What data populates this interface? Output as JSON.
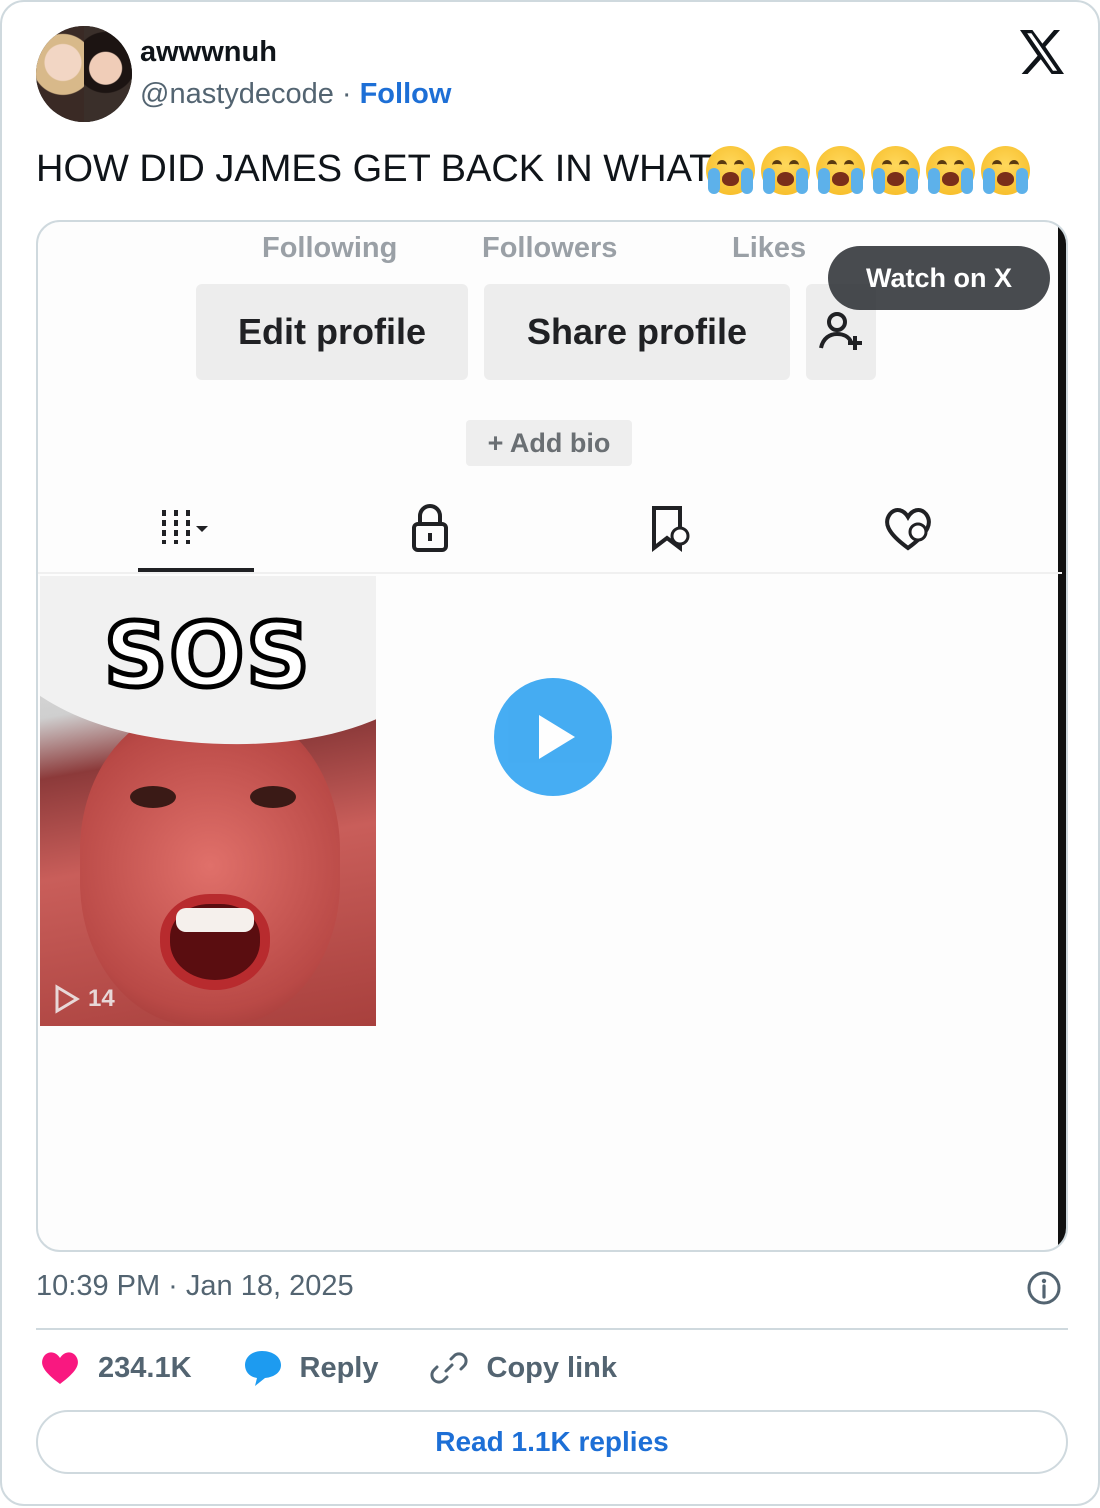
{
  "author": {
    "name": "awwwnuh",
    "handle": "@nastydecode",
    "separator": "·",
    "follow_label": "Follow"
  },
  "tweet": {
    "text": "HOW DID JAMES GET BACK IN WHAT",
    "emoji_count": 6,
    "emoji_name": "loudly-crying-face"
  },
  "media": {
    "watch_label": "Watch on X",
    "screen": {
      "stats": [
        "Following",
        "Followers",
        "Likes"
      ],
      "edit_profile": "Edit profile",
      "share_profile": "Share profile",
      "add_bio": "+ Add bio",
      "tabs": [
        "grid-icon",
        "lock-icon",
        "bookmark-icon",
        "liked-icon"
      ],
      "thumbnail_caption": "SOS",
      "thumbnail_views": "14"
    }
  },
  "meta": {
    "timestamp": "10:39 PM · Jan 18, 2025"
  },
  "actions": {
    "likes": "234.1K",
    "reply_label": "Reply",
    "copy_label": "Copy link",
    "read_replies": "Read 1.1K replies"
  },
  "colors": {
    "link": "#1d6fd6",
    "like": "#f91880",
    "reply": "#1d9bf0",
    "muted": "#536471",
    "border": "#cfd9de"
  }
}
